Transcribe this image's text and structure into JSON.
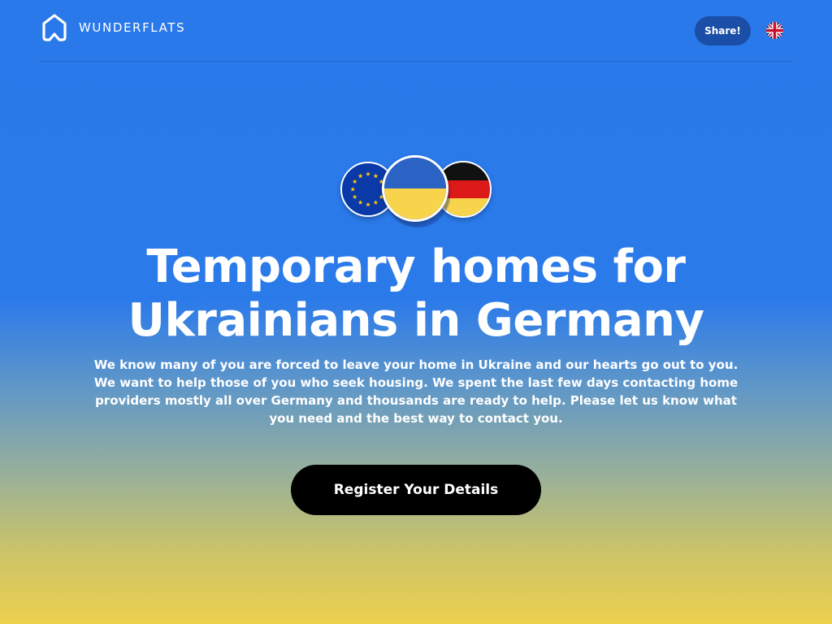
{
  "header": {
    "brand": "WUNDERFLATS",
    "logo_icon": "house-outline-icon",
    "share_label": "Share!",
    "language_icon": "uk-flag-icon"
  },
  "hero": {
    "flags": [
      "eu-flag-icon",
      "ukraine-flag-icon",
      "germany-flag-icon"
    ],
    "headline_line1": "Temporary homes for",
    "headline_line2": "Ukrainians in Germany",
    "intro": "We know many of you are forced to leave your home in Ukraine and our hearts go out to you. We want to help those of you who seek housing. We spent the last few days contacting home providers mostly all over Germany and thousands are ready to help. Please let us know what you need and the best way to contact you.",
    "cta_label": "Register Your Details"
  },
  "colors": {
    "background_top": "#2a79ea",
    "background_bottom": "#ecd04e",
    "share_button": "#1b4ea6",
    "cta_button": "#000000",
    "text": "#ffffff"
  }
}
